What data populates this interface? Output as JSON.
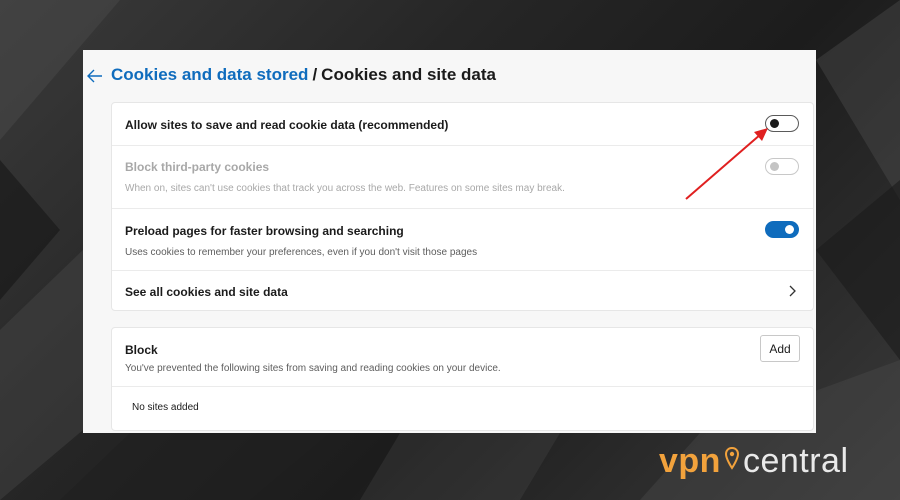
{
  "header": {
    "breadcrumb_parent": "Cookies and data stored",
    "separator": "/",
    "current_page": "Cookies and site data"
  },
  "settings": [
    {
      "title": "Allow sites to save and read cookie data (recommended)",
      "description": "",
      "state": "off",
      "enabled": true
    },
    {
      "title": "Block third-party cookies",
      "description": "When on, sites can't use cookies that track you across the web. Features on some sites may break.",
      "state": "off",
      "enabled": false
    },
    {
      "title": "Preload pages for faster browsing and searching",
      "description": "Uses cookies to remember your preferences, even if you don't visit those pages",
      "state": "on",
      "enabled": true
    },
    {
      "title": "See all cookies and site data",
      "description": ""
    }
  ],
  "block_section": {
    "title": "Block",
    "description": "You've prevented the following sites from saving and reading cookies on your device.",
    "add_label": "Add",
    "empty_text": "No sites added"
  },
  "watermark": {
    "part1": "vpn",
    "part2": "central"
  },
  "colors": {
    "accent": "#0f6cbd",
    "annotation_arrow": "#e02020",
    "logo_orange": "#f2a23c"
  },
  "icons": {
    "back": "arrow-left-icon",
    "chevron": "chevron-right-icon",
    "logo_pin": "location-pin-icon"
  }
}
